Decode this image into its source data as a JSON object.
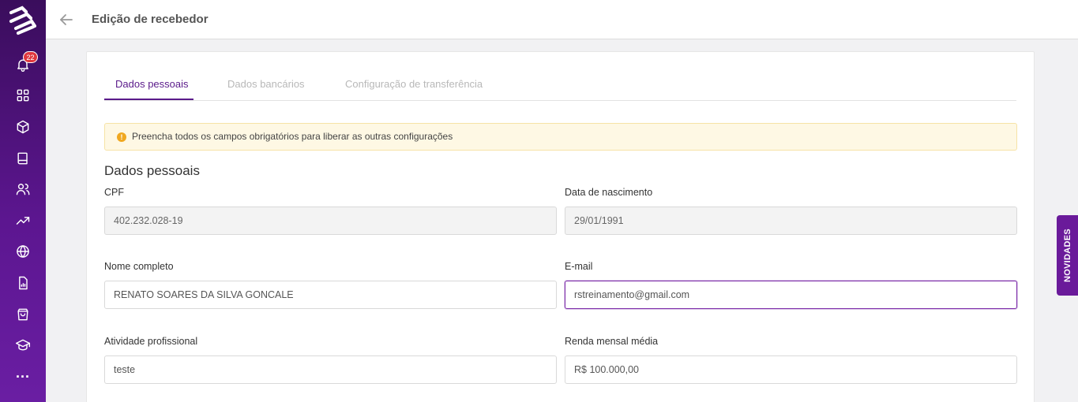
{
  "header": {
    "title": "Edição de recebedor"
  },
  "sidebar": {
    "notification_count": "22",
    "items": [
      {
        "icon": "bell-icon"
      },
      {
        "icon": "grid-icon"
      },
      {
        "icon": "box-icon"
      },
      {
        "icon": "book-icon"
      },
      {
        "icon": "users-icon"
      },
      {
        "icon": "trending-up-icon"
      },
      {
        "icon": "globe-icon"
      },
      {
        "icon": "document-chart-icon"
      },
      {
        "icon": "shopping-bag-icon"
      },
      {
        "icon": "graduation-cap-icon"
      }
    ],
    "more_label": "..."
  },
  "tabs": [
    {
      "label": "Dados pessoais",
      "active": true
    },
    {
      "label": "Dados bancários",
      "active": false
    },
    {
      "label": "Configuração de transferência",
      "active": false
    }
  ],
  "alert": {
    "icon": "!",
    "text": "Preencha todos os campos obrigatórios para liberar as outras configurações"
  },
  "form": {
    "section_title": "Dados pessoais",
    "cpf": {
      "label": "CPF",
      "value": "402.232.028-19"
    },
    "birth_date": {
      "label": "Data de nascimento",
      "value": "29/01/1991"
    },
    "full_name": {
      "label": "Nome completo",
      "value": "RENATO SOARES DA SILVA GONCALE"
    },
    "email": {
      "label": "E-mail",
      "value": "rstreinamento@gmail.com"
    },
    "profession": {
      "label": "Atividade profissional",
      "value": "teste"
    },
    "income": {
      "label": "Renda mensal média",
      "value": "R$ 100.000,00"
    }
  },
  "novidades": {
    "label": "NOVIDADES"
  },
  "colors": {
    "brand_purple": "#5a1a8a",
    "sidebar_gradient_top": "#3a0d5c",
    "alert_background": "#fef8e4",
    "badge_red": "#e0383e"
  }
}
